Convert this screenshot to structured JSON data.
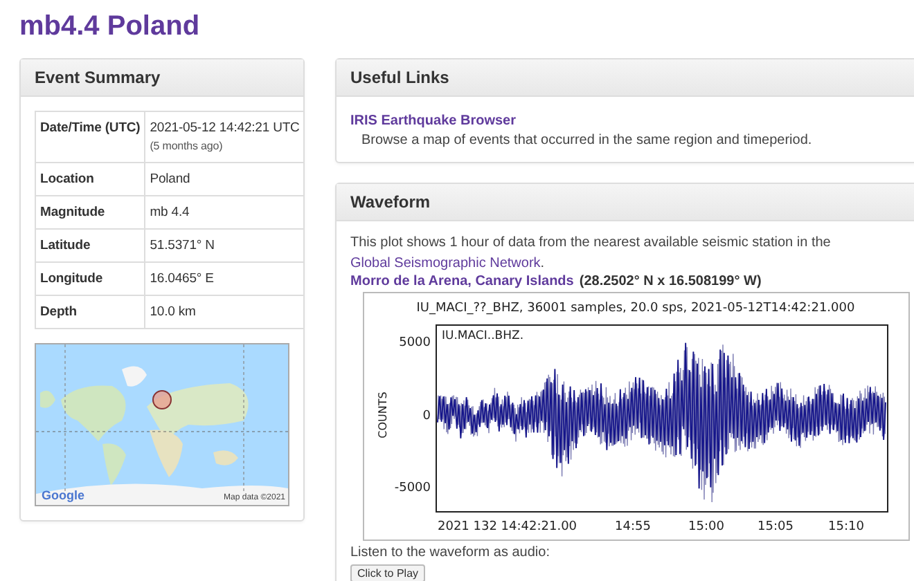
{
  "page_title": "mb4.4 Poland",
  "event_summary": {
    "title": "Event Summary",
    "rows": [
      {
        "label": "Date/Time (UTC)",
        "value": "2021-05-12 14:42:21 UTC",
        "note": "(5 months ago)"
      },
      {
        "label": "Location",
        "value": "Poland"
      },
      {
        "label": "Magnitude",
        "value": "mb 4.4"
      },
      {
        "label": "Latitude",
        "value": "51.5371° N"
      },
      {
        "label": "Longitude",
        "value": "16.0465° E"
      },
      {
        "label": "Depth",
        "value": "10.0 km"
      }
    ],
    "map": {
      "logo": "Google",
      "attribution": "Map data ©2021"
    }
  },
  "useful_links": {
    "title": "Useful Links",
    "links": [
      {
        "label": "IRIS Earthquake Browser",
        "description": "Browse a map of events that occurred in the same region and timeperiod."
      }
    ]
  },
  "waveform": {
    "title": "Waveform",
    "intro": "This plot shows 1 hour of data from the nearest available seismic station in the",
    "intro_link": "Global Seismographic Network",
    "intro_end": ".",
    "station_link": "Morro de la Arena, Canary Islands",
    "station_coords": "(28.2502° N x 16.508199° W)",
    "plot": {
      "title": "IU_MACI_??_BHZ, 36001 samples, 20.0 sps, 2021-05-12T14:42:21.000",
      "trace_label": "IU.MACI..BHZ.",
      "ylabel": "COUNTS",
      "yticks": [
        "5000",
        "0",
        "-5000"
      ],
      "xticks": [
        "2021 132 14:42:21.00",
        "14:55",
        "15:00",
        "15:05",
        "15:10"
      ]
    },
    "audio_label": "Listen to the waveform as audio:",
    "play_button": "Click to Play"
  }
}
